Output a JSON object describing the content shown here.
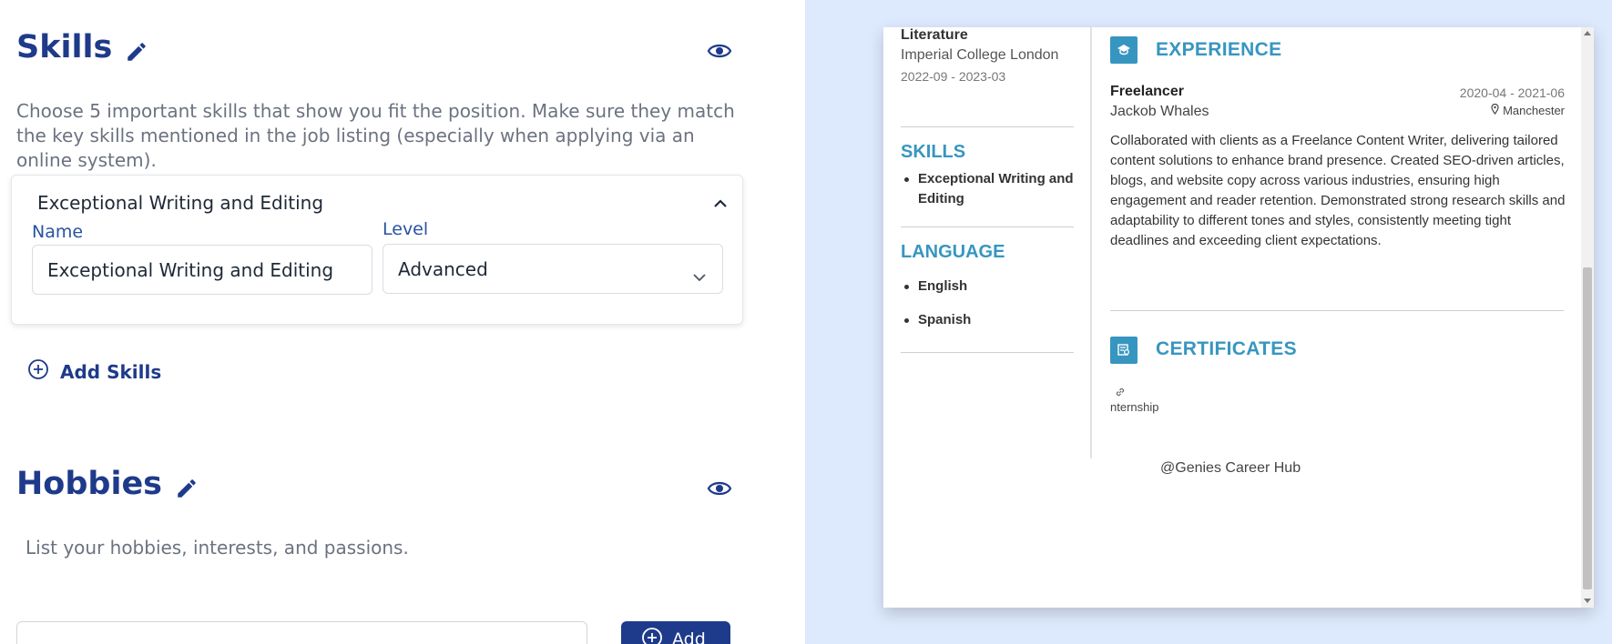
{
  "editor": {
    "skills": {
      "title": "Skills",
      "description": "Choose 5 important skills that show you fit the position. Make sure they match the key skills mentioned in the job listing (especially when applying via an online system).",
      "card": {
        "header": "Exceptional Writing and Editing",
        "name_label": "Name",
        "name_value": "Exceptional Writing and Editing",
        "level_label": "Level",
        "level_value": "Advanced"
      },
      "add_label": "Add Skills"
    },
    "hobbies": {
      "title": "Hobbies",
      "description": "List your hobbies, interests, and passions.",
      "add_button": "Add"
    }
  },
  "preview": {
    "education": {
      "degree": "Literature",
      "school": "Imperial College London",
      "dates": "2022-09 - 2023-03"
    },
    "skills": {
      "heading": "SKILLS",
      "items": [
        "Exceptional Writing and Editing"
      ]
    },
    "language": {
      "heading": "LANGUAGE",
      "items": [
        "English",
        "Spanish"
      ]
    },
    "experience": {
      "heading": "EXPERIENCE",
      "job_title": "Freelancer",
      "company": "Jackob Whales",
      "dates": "2020-04 - 2021-06",
      "location": "Manchester",
      "description": "Collaborated with clients as a Freelance Content Writer, delivering tailored content solutions to enhance brand presence. Created SEO-driven articles, blogs, and website copy across various industries, ensuring high engagement and reader retention. Demonstrated strong research skills and adaptability to different tones and styles, consistently meeting tight deadlines and exceeding client expectations."
    },
    "certificates": {
      "heading": "CERTIFICATES",
      "item": "nternship"
    },
    "footer": "@Genies Career Hub"
  },
  "colors": {
    "editor_accent": "#1e3a8a",
    "resume_accent": "#3796c0",
    "preview_background": "#dde9fd"
  }
}
